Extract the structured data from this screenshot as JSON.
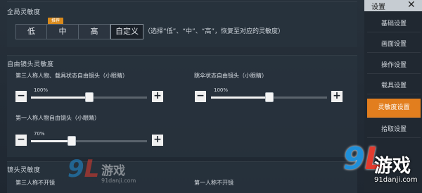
{
  "global": {
    "title": "全局灵敏度",
    "badge": "推荐",
    "options": [
      "低",
      "中",
      "高",
      "自定义"
    ],
    "selected": "自定义",
    "hint": "（选择“低”、“中”、“高”，恢复至对应的灵敏度）"
  },
  "free_camera": {
    "title": "自由镜头灵敏度",
    "third_person_label": "第三人称人物、载具状态自由镜头（小眼睛）",
    "third_person_value": "100%",
    "third_person_level": 1.0,
    "parachute_label": "跳伞状态自由镜头（小眼睛）",
    "parachute_value": "100%",
    "parachute_level": 1.0,
    "first_person_label": "第一人称人物自由镜头（小眼睛）",
    "first_person_value": "70%",
    "first_person_level": 0.7,
    "minus": "−",
    "plus": "+"
  },
  "lens": {
    "title": "镜头灵敏度",
    "third_no_scope": "第三人称不开镜",
    "first_no_scope": "第一人称不开镜"
  },
  "sidebar": {
    "title": "设置",
    "close": "✕",
    "items": [
      "基础设置",
      "画面设置",
      "操作设置",
      "载具设置",
      "灵敏度设置",
      "拾取设置"
    ],
    "active": "灵敏度设置"
  },
  "watermark": {
    "logo": "9",
    "logo_l": "L",
    "text": "游戏",
    "url": "91danji.com"
  },
  "colors": {
    "accent": "#e27e1e",
    "watermark_blue": "#1f8fd8",
    "watermark_red": "#e23b2e"
  }
}
